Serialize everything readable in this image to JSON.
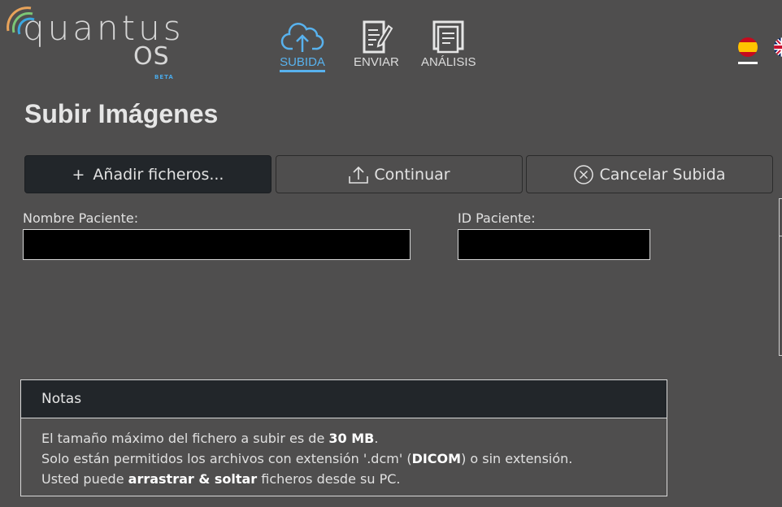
{
  "logo": {
    "word": "quantus",
    "os": "OS",
    "beta": "BETA"
  },
  "nav": [
    {
      "label": "SUBIDA",
      "icon": "cloud-upload-icon",
      "active": true
    },
    {
      "label": "ENVIAR",
      "icon": "edit-document-icon",
      "active": false
    },
    {
      "label": "ANÁLISIS",
      "icon": "documents-icon",
      "active": false
    }
  ],
  "languages": {
    "spanish": "spain-flag-icon",
    "english": "uk-flag-icon"
  },
  "page": {
    "title": "Subir Imágenes"
  },
  "toolbar": {
    "add_label": "Añadir ficheros...",
    "add_prefix": "+",
    "continue_label": "Continuar",
    "cancel_label": "Cancelar Subida"
  },
  "form": {
    "patient_name_label": "Nombre Paciente:",
    "patient_name_value": "",
    "patient_id_label": "ID Paciente:",
    "patient_id_value": ""
  },
  "notes": {
    "title": "Notas",
    "line1_pre": "El tamaño máximo del fichero a subir es de ",
    "line1_bold": "30 MB",
    "line1_post": ".",
    "line2_pre": "Solo están permitidos los archivos con extensión '.dcm' (",
    "line2_bold": "DICOM",
    "line2_post": ") o sin extensión.",
    "line3_pre": "Usted puede ",
    "line3_bold": "arrastrar & soltar",
    "line3_post": " ficheros desde su PC."
  },
  "colors": {
    "accent": "#58b2ee",
    "background": "#4f4e4e",
    "dark_panel": "#22262a"
  }
}
